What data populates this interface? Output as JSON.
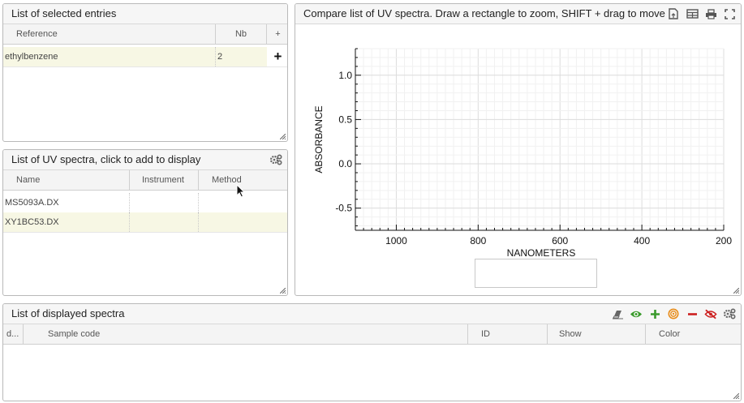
{
  "selected_entries": {
    "title": "List of selected entries",
    "columns": [
      "Reference",
      "Nb",
      "+"
    ],
    "rows": [
      {
        "reference": "ethylbenzene",
        "nb": "2",
        "action": "+"
      }
    ]
  },
  "uv_list": {
    "title": "List of UV spectra, click to add to display",
    "columns": [
      "Name",
      "Instrument",
      "Method"
    ],
    "rows": [
      {
        "name": "MS5093A.DX",
        "instrument": "",
        "method": ""
      },
      {
        "name": "XY1BC53.DX",
        "instrument": "",
        "method": ""
      }
    ]
  },
  "compare": {
    "title": "Compare list of UV spectra. Draw a rectangle to zoom, SHIFT + drag to move"
  },
  "displayed": {
    "title": "List of displayed spectra",
    "columns": [
      "d...",
      "Sample code",
      "ID",
      "Show",
      "Color"
    ]
  },
  "icons": {
    "compare_toolbar": [
      "export-file-icon",
      "table-icon",
      "print-icon",
      "fullscreen-icon"
    ],
    "displayed_toolbar": [
      "eraser-icon",
      "eye-icon",
      "plus-icon",
      "target-icon",
      "minus-icon",
      "eye-slash-icon",
      "gears-icon"
    ],
    "uv_toolbar": [
      "gears-icon"
    ]
  },
  "colors": {
    "selected_row": "#f7f7e4",
    "green": "#3a9a2c",
    "red": "#cc1f1f",
    "orange": "#e88c1a"
  },
  "chart_data": {
    "type": "line",
    "xlabel": "NANOMETERS",
    "ylabel": "ABSORBANCE",
    "xlim": [
      1100,
      200
    ],
    "ylim": [
      -0.75,
      1.3
    ],
    "x_ticks": [
      1000,
      800,
      600,
      400,
      200
    ],
    "y_ticks": [
      1.0,
      0.5,
      0.0,
      -0.5
    ],
    "x_tick_labels": [
      "1000",
      "800",
      "600",
      "400",
      "200"
    ],
    "y_tick_labels": [
      "1.0",
      "0.5",
      "0.0",
      "-0.5"
    ],
    "x_reversed": true,
    "grid": true,
    "series": []
  }
}
